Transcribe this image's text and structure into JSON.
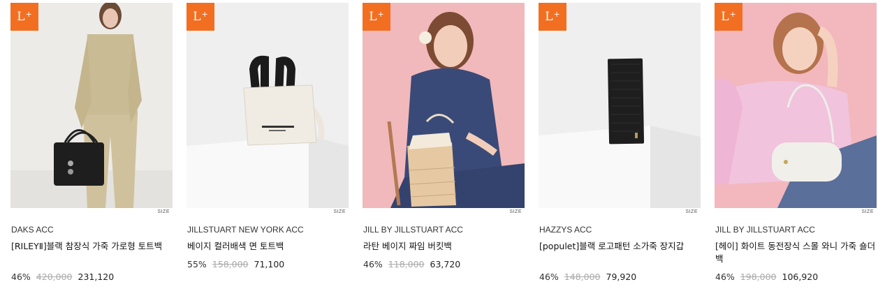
{
  "badge": {
    "label": "L",
    "plus": "+"
  },
  "size_label": "SIZE",
  "products": [
    {
      "brand": "DAKS ACC",
      "name": "[RILEYⅡ]블랙 참장식 가죽 가로형 토트백",
      "discount": "46%",
      "original": "420,000",
      "sale": "231,120"
    },
    {
      "brand": "JILLSTUART NEW YORK ACC",
      "name": "베이지 컬러배색 면 토트백",
      "discount": "55%",
      "original": "158,000",
      "sale": "71,100"
    },
    {
      "brand": "JILL BY JILLSTUART ACC",
      "name": "라탄 베이지 짜임 버킷백",
      "discount": "46%",
      "original": "118,000",
      "sale": "63,720"
    },
    {
      "brand": "HAZZYS ACC",
      "name": "[populet]블랙 로고패턴 소가죽 장지갑",
      "discount": "46%",
      "original": "148,000",
      "sale": "79,920"
    },
    {
      "brand": "JILL BY JILLSTUART ACC",
      "name": "[헤이] 화이트 동전장식 스몰 와니 가죽 숄더백",
      "discount": "46%",
      "original": "198,000",
      "sale": "106,920"
    }
  ],
  "colors": {
    "badge": "#f26f21",
    "strike": "#aaaaaa"
  }
}
